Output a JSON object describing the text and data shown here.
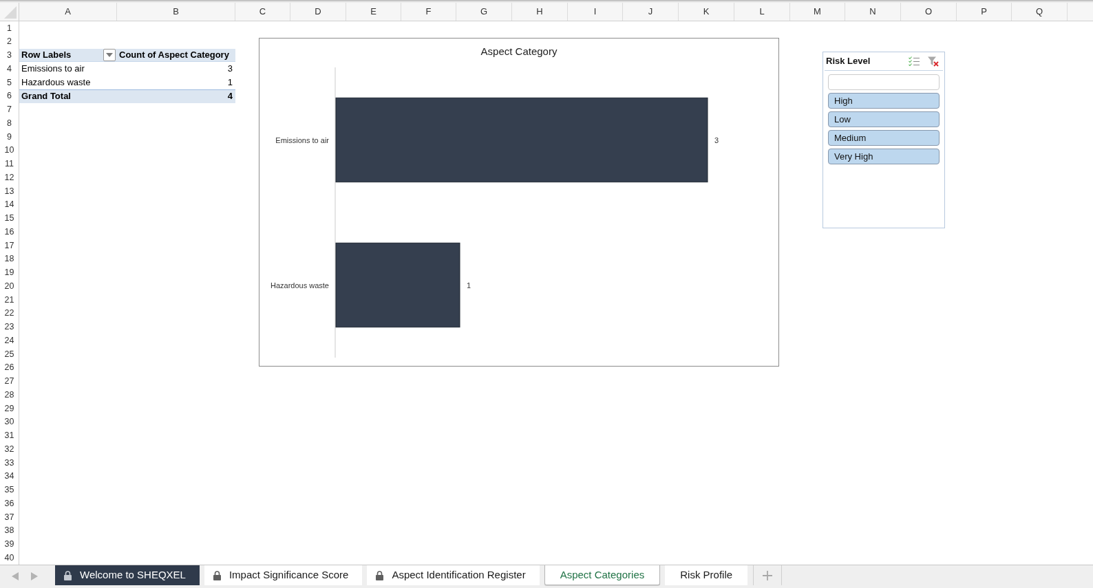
{
  "sheet": {
    "columns": [
      "A",
      "B",
      "C",
      "D",
      "E",
      "F",
      "G",
      "H",
      "I",
      "J",
      "K",
      "L",
      "M",
      "N",
      "O",
      "P",
      "Q"
    ],
    "rows": [
      "1",
      "2",
      "3",
      "4",
      "5",
      "6",
      "7",
      "8",
      "9",
      "10",
      "11",
      "12",
      "13",
      "14",
      "15",
      "16",
      "17",
      "18",
      "19",
      "20",
      "21",
      "22",
      "23",
      "24",
      "25",
      "26",
      "27",
      "28",
      "29",
      "30",
      "31",
      "32",
      "33",
      "34",
      "35",
      "36",
      "37",
      "38",
      "39",
      "40"
    ]
  },
  "pivot_table": {
    "header": {
      "row_labels": "Row Labels",
      "values": "Count of Aspect Category"
    },
    "rows": [
      {
        "label": "Emissions to air",
        "count": "3"
      },
      {
        "label": "Hazardous waste",
        "count": "1"
      }
    ],
    "grand_total": {
      "label": "Grand Total",
      "count": "4"
    }
  },
  "chart": {
    "chart_data": {
      "type": "bar",
      "orientation": "horizontal",
      "title": "Aspect Category",
      "categories": [
        "Emissions to air",
        "Hazardous waste"
      ],
      "series": [
        {
          "color": "#353f4f",
          "values": [
            3,
            1
          ]
        }
      ],
      "data_labels": true
    }
  },
  "slicer": {
    "title": "Risk Level",
    "items": [
      {
        "label": "High",
        "selected": true
      },
      {
        "label": "Low",
        "selected": true
      },
      {
        "label": "Medium",
        "selected": true
      },
      {
        "label": "Very High",
        "selected": true
      }
    ]
  },
  "sheet_tabs": [
    {
      "label": "Welcome to SHEQXEL",
      "locked": true,
      "selected": false,
      "color": "#2f3a4b"
    },
    {
      "label": "Impact Significance Score",
      "locked": true,
      "selected": false
    },
    {
      "label": "Aspect Identification Register",
      "locked": true,
      "selected": false
    },
    {
      "label": "Aspect Categories",
      "locked": false,
      "selected": true
    },
    {
      "label": "Risk Profile",
      "locked": false,
      "selected": false
    }
  ]
}
